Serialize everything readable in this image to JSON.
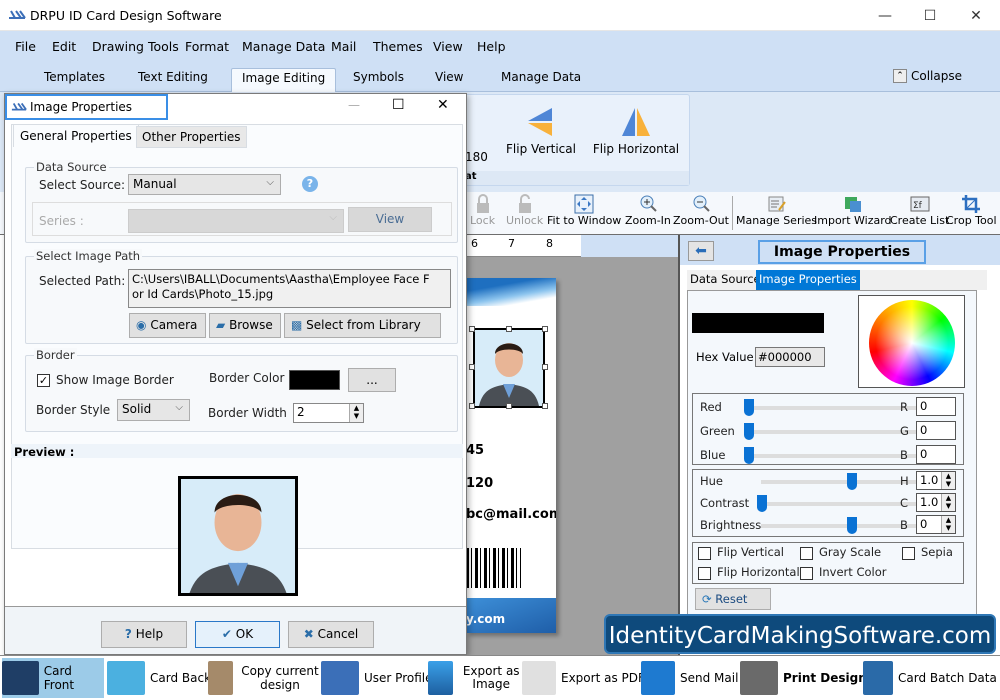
{
  "app": {
    "title": "DRPU ID Card Design Software"
  },
  "window_controls": {
    "minimize": "—",
    "maximize": "☐",
    "close": "✕"
  },
  "menu": [
    "File",
    "Edit",
    "Drawing Tools",
    "Format",
    "Manage Data",
    "Mail",
    "Themes",
    "View",
    "Help"
  ],
  "ribbon_tabs": [
    "Templates",
    "Text Editing",
    "Image Editing",
    "Symbols",
    "View",
    "Manage Data"
  ],
  "ribbon_active_tab": "Image Editing",
  "collapse_label": "Collapse",
  "ribbon_group": {
    "partial_label": "180",
    "flip_vertical": "Flip Vertical",
    "flip_horizontal": "Flip Horizontal",
    "group_label_partial": "at"
  },
  "toolbar": [
    "Lock",
    "Unlock",
    "Fit to Window",
    "Zoom-In",
    "Zoom-Out",
    "Manage Series",
    "Import Wizard",
    "Create List",
    "Crop Tool"
  ],
  "ruler_ticks": [
    "6",
    "7",
    "8"
  ],
  "card": {
    "line1": "45",
    "line2": "120",
    "line3": "bc@mail.com",
    "footer": "y.com"
  },
  "dialog": {
    "title": "Image Properties",
    "tabs": [
      "General  Properties",
      "Other Properties"
    ],
    "active_tab": "General  Properties",
    "data_source": {
      "legend": "Data Source",
      "select_source_label": "Select Source:",
      "select_source_value": "Manual",
      "series_label": "Series :",
      "series_value": "",
      "view_button": "View"
    },
    "image_path": {
      "legend": "Select Image Path",
      "selected_path_label": "Selected Path:",
      "selected_path_value": "C:\\Users\\IBALL\\Documents\\Aastha\\Employee Face For Id Cards\\Photo_15.jpg",
      "camera_button": "Camera",
      "browse_button": "Browse",
      "library_button": "Select from Library"
    },
    "border": {
      "legend": "Border",
      "show_border_label": "Show Image Border",
      "show_border_checked": true,
      "border_color_label": "Border Color",
      "border_color": "#000000",
      "color_picker_button": "...",
      "border_style_label": "Border Style",
      "border_style_value": "Solid",
      "border_width_label": "Border Width",
      "border_width_value": "2"
    },
    "preview_label": "Preview :",
    "help_button": "Help",
    "ok_button": "OK",
    "cancel_button": "Cancel"
  },
  "right_panel": {
    "title": "Image Properties",
    "tabs": [
      "Data Source",
      "Image Properties"
    ],
    "active_tab": "Image Properties",
    "hex_label": "Hex Value",
    "hex_value": "#000000",
    "swatch_color": "#000000",
    "rgb": [
      {
        "label": "Red",
        "letter": "R",
        "value": "0",
        "fraction": 0
      },
      {
        "label": "Green",
        "letter": "G",
        "value": "0",
        "fraction": 0
      },
      {
        "label": "Blue",
        "letter": "B",
        "value": "0",
        "fraction": 0
      }
    ],
    "adjust": [
      {
        "label": "Hue",
        "letter": "H",
        "value": "1.0",
        "fraction": 0.5
      },
      {
        "label": "Contrast",
        "letter": "C",
        "value": "1.0",
        "fraction": 0.0
      },
      {
        "label": "Brightness",
        "letter": "B",
        "value": "0",
        "fraction": 0.5
      }
    ],
    "checkboxes": [
      {
        "label": "Flip Vertical",
        "checked": false
      },
      {
        "label": "Gray Scale",
        "checked": false
      },
      {
        "label": "Sepia",
        "checked": false
      },
      {
        "label": "Flip Horizontal",
        "checked": false
      },
      {
        "label": "Invert Color",
        "checked": false
      }
    ],
    "reset_button": "Reset"
  },
  "watermark": "IdentityCardMakingSoftware.com",
  "bottom_bar": [
    "Card Front",
    "Card Back",
    "Copy current design",
    "User Profile",
    "Export as Image",
    "Export as PDF",
    "Send Mail",
    "Print Design",
    "Card Batch Data"
  ],
  "bottom_active": "Card Front",
  "colors": {
    "accent": "#0078d7",
    "menu_bg": "#cfe0f5",
    "watermark_bg": "#0e4a7c"
  }
}
